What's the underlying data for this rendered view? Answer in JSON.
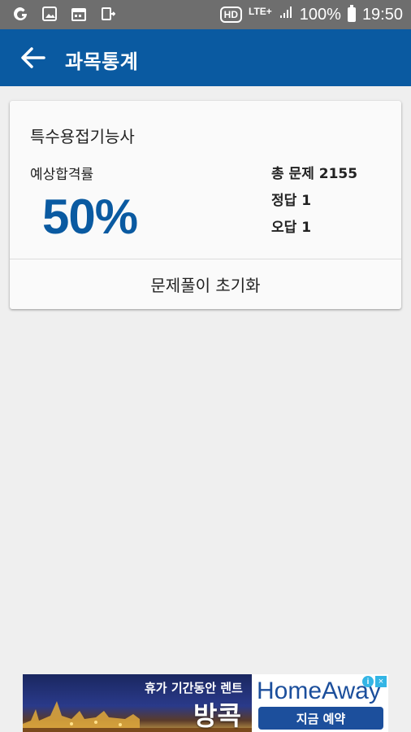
{
  "status_bar": {
    "network_tag": "HD",
    "lte_label": "LTE+",
    "battery_text": "100%",
    "time": "19:50",
    "icons": [
      "g-app-icon",
      "image-icon",
      "calendar-icon",
      "usb-icon",
      "hd-icon",
      "lte-icon",
      "signal-icon",
      "battery-icon"
    ]
  },
  "app_bar": {
    "title": "과목통계",
    "back_icon": "arrow-left-icon",
    "background_color": "#0a5aa1"
  },
  "card": {
    "subject_title": "특수용접기능사",
    "pass_rate_label": "예상합격률",
    "pass_rate_value": "50%",
    "accent_color": "#0a5aa1",
    "stats": {
      "total_label": "총 문제 2155",
      "correct_label": "정답 1",
      "wrong_label": "오답 1"
    },
    "reset_button_label": "문제풀이 초기화"
  },
  "ad": {
    "headline": "휴가 기간동안 렌트",
    "city": "방콕",
    "brand": "HomeAway",
    "cta_label": "지금 예약",
    "info_icon": "info-icon",
    "close_icon": "close-icon"
  }
}
